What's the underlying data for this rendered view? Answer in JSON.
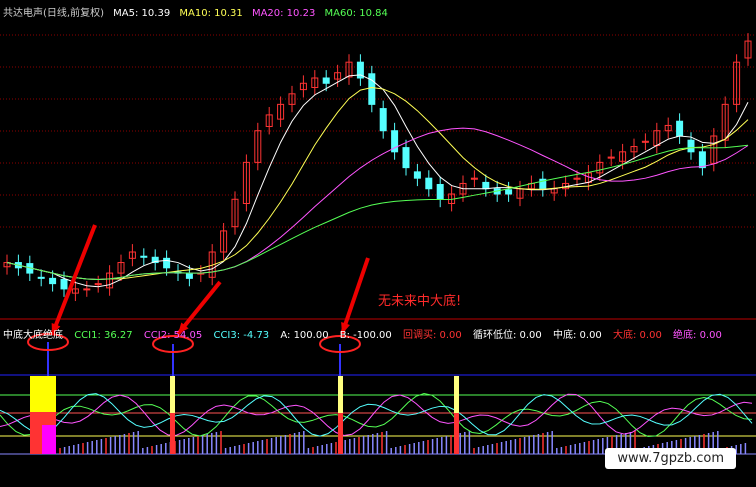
{
  "header": {
    "title": "共达电声(日线,前复权)",
    "ma": [
      {
        "label": "MA5: 10.39",
        "color": "#ffffff"
      },
      {
        "label": "MA10: 10.31",
        "color": "#ffff55"
      },
      {
        "label": "MA20: 10.23",
        "color": "#ff55ff"
      },
      {
        "label": "MA60: 10.84",
        "color": "#55ff55"
      }
    ]
  },
  "indicator": {
    "title": "中底大底绝底",
    "title_color": "#ffffff",
    "values": [
      {
        "label": "CCI1: 36.27",
        "color": "#55ff55"
      },
      {
        "label": "CCI2: 54.05",
        "color": "#ff55ff"
      },
      {
        "label": "CCI3: -4.73",
        "color": "#55ffff"
      },
      {
        "label": "A: 100.00",
        "color": "#ffffff"
      },
      {
        "label": "B: -100.00",
        "color": "#ffffff"
      },
      {
        "label": "回调买: 0.00",
        "color": "#ff3333"
      },
      {
        "label": "循环低位: 0.00",
        "color": "#ffffff"
      },
      {
        "label": "中底: 0.00",
        "color": "#ffffff"
      },
      {
        "label": "大底: 0.00",
        "color": "#ff3333"
      },
      {
        "label": "绝底: 0.00",
        "color": "#ff55ff"
      }
    ]
  },
  "annotation": "无未来中大底!",
  "watermark": "www.7gpzb.com",
  "colors": {
    "up": "#ff3333",
    "down": "#55ffff",
    "grid": "#8b0000"
  },
  "chart_data": {
    "type": "candlestick",
    "note": "价格数值根据图形估读",
    "close": [
      9.4,
      9.3,
      9.2,
      9.1,
      9.0,
      8.9,
      8.9,
      8.9,
      9.0,
      9.2,
      9.4,
      9.6,
      9.5,
      9.4,
      9.3,
      9.2,
      9.1,
      9.2,
      9.6,
      10.0,
      10.6,
      11.3,
      11.9,
      12.2,
      12.4,
      12.6,
      12.8,
      12.9,
      12.8,
      13.0,
      13.2,
      12.9,
      12.4,
      11.9,
      11.5,
      11.2,
      11.0,
      10.8,
      10.6,
      10.7,
      10.9,
      11.0,
      10.8,
      10.7,
      10.7,
      10.8,
      10.9,
      10.8,
      10.8,
      10.9,
      11.0,
      11.1,
      11.3,
      11.4,
      11.5,
      11.6,
      11.7,
      11.9,
      12.0,
      11.8,
      11.5,
      11.2,
      11.8,
      12.4,
      13.2,
      13.6
    ]
  }
}
